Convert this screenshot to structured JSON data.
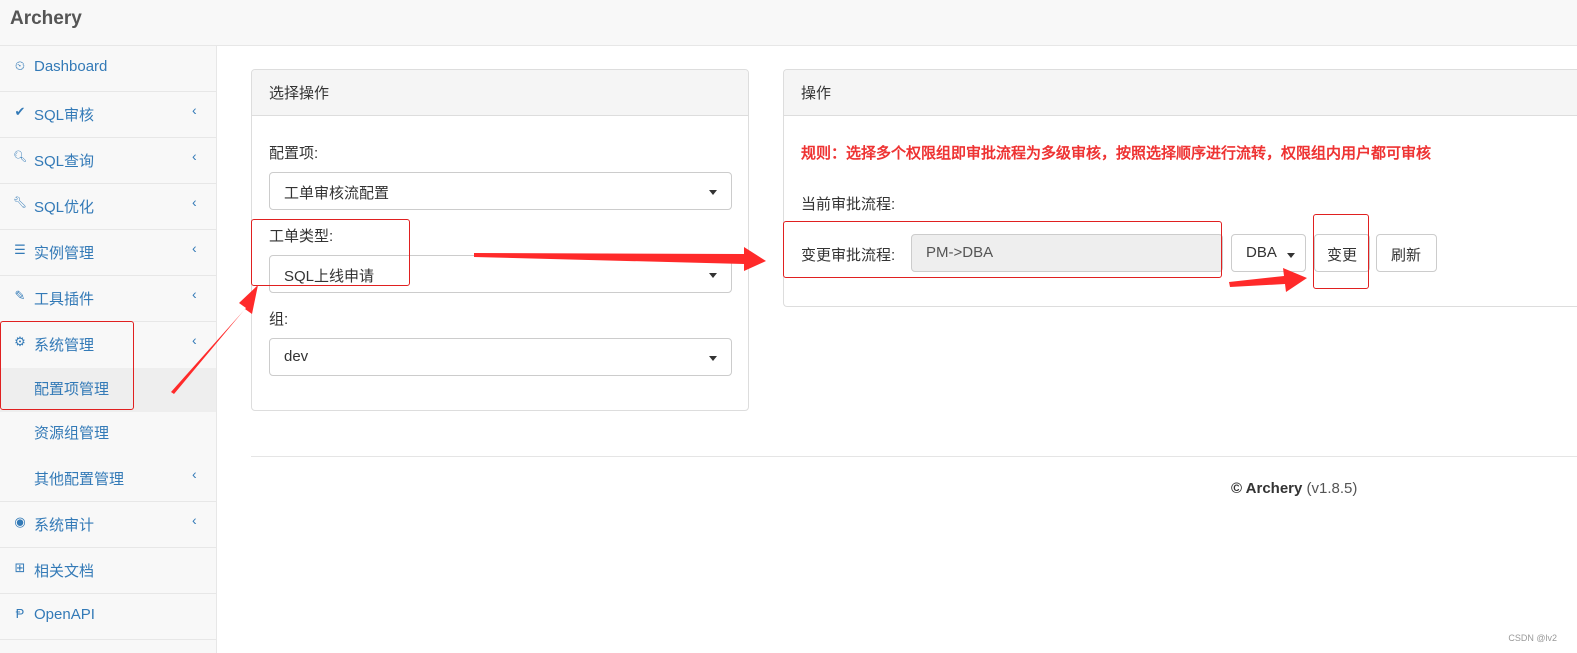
{
  "app": {
    "title": "Archery"
  },
  "sidebar": {
    "items": [
      {
        "label": "Dashboard",
        "icon": "dashboard-icon",
        "glyph": "⏲",
        "chevron": ""
      },
      {
        "label": "SQL审核",
        "icon": "check-icon",
        "glyph": "✔",
        "chevron": "‹"
      },
      {
        "label": "SQL查询",
        "icon": "search-icon",
        "glyph": "🔍︎",
        "chevron": "‹"
      },
      {
        "label": "SQL优化",
        "icon": "wrench-icon",
        "glyph": "🔧︎",
        "chevron": "‹"
      },
      {
        "label": "实例管理",
        "icon": "database-icon",
        "glyph": "☰",
        "chevron": "‹"
      },
      {
        "label": "工具插件",
        "icon": "plug-icon",
        "glyph": "✎",
        "chevron": "‹"
      },
      {
        "label": "系统管理",
        "icon": "gears-icon",
        "glyph": "⚙",
        "chevron": "‹"
      },
      {
        "label": "配置项管理",
        "icon": "",
        "glyph": "",
        "chevron": ""
      },
      {
        "label": "资源组管理",
        "icon": "",
        "glyph": "",
        "chevron": ""
      },
      {
        "label": "其他配置管理",
        "icon": "",
        "glyph": "",
        "chevron": "‹"
      },
      {
        "label": "系统审计",
        "icon": "eye-icon",
        "glyph": "◉",
        "chevron": "‹"
      },
      {
        "label": "相关文档",
        "icon": "sitemap-icon",
        "glyph": "⊞",
        "chevron": ""
      },
      {
        "label": "OpenAPI",
        "icon": "branch-icon",
        "glyph": "Ᵽ",
        "chevron": ""
      }
    ]
  },
  "left_panel": {
    "heading": "选择操作",
    "config_label": "配置项:",
    "config_value": "工单审核流配置",
    "type_label": "工单类型:",
    "type_value": "SQL上线申请",
    "group_label": "组:",
    "group_value": "dev"
  },
  "right_panel": {
    "heading": "操作",
    "rule_text": "规则：选择多个权限组即审批流程为多级审核，按照选择顺序进行流转，权限组内用户都可审核",
    "current_label": "当前审批流程:",
    "change_label": "变更审批流程:",
    "flow_value": "PM->DBA",
    "dba_button": "DBA",
    "change_button": "变更",
    "refresh_button": "刷新"
  },
  "footer": {
    "copyright": "© Archery",
    "version": "(v1.8.5)"
  },
  "watermark": "CSDN @lv2",
  "colors": {
    "link": "#337ab7",
    "rule_red": "#e33333",
    "annotation_red": "#e02020"
  }
}
